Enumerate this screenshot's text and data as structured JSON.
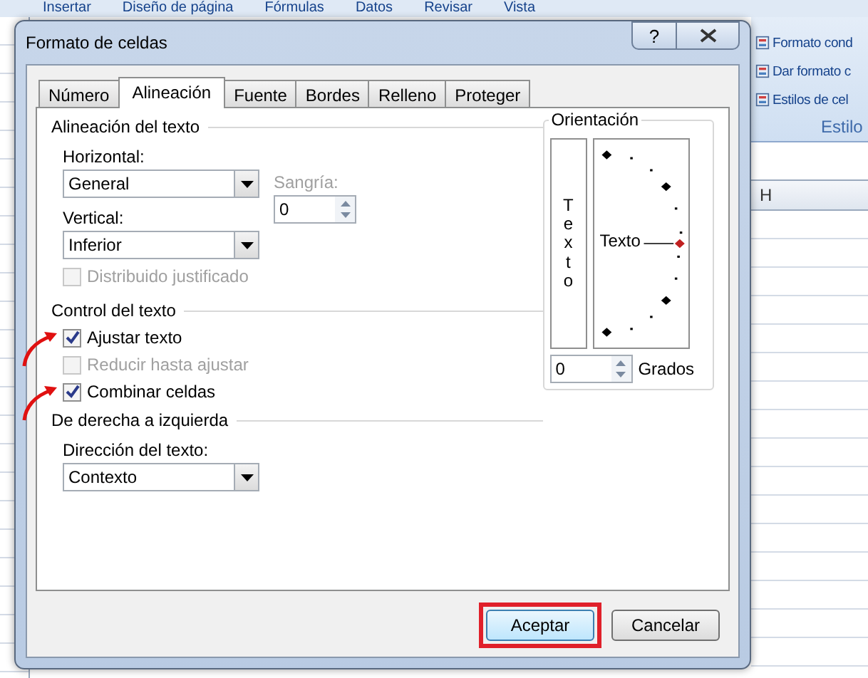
{
  "background": {
    "ribbon_tabs": [
      "Insertar",
      "Diseño de página",
      "Fórmulas",
      "Datos",
      "Revisar",
      "Vista"
    ],
    "ribbon_items": [
      "Formato cond",
      "Dar formato c",
      "Estilos de cel"
    ],
    "ribbon_group": "Estilo",
    "column_header": "H"
  },
  "dialog": {
    "title": "Formato de celdas",
    "help": "?",
    "tabs": [
      {
        "label": "Número",
        "selected": false
      },
      {
        "label": "Alineación",
        "selected": true
      },
      {
        "label": "Fuente",
        "selected": false
      },
      {
        "label": "Bordes",
        "selected": false
      },
      {
        "label": "Relleno",
        "selected": false
      },
      {
        "label": "Proteger",
        "selected": false
      }
    ],
    "text_alignment": {
      "title": "Alineación del texto",
      "horizontal": {
        "label": "Horizontal:",
        "value": "General"
      },
      "vertical": {
        "label": "Vertical:",
        "value": "Inferior"
      },
      "indent": {
        "label": "Sangría:",
        "value": "0"
      },
      "distributed": {
        "label": "Distribuido justificado",
        "checked": false,
        "disabled": true
      }
    },
    "text_control": {
      "title": "Control del texto",
      "options": [
        {
          "label": "Ajustar texto",
          "checked": true,
          "disabled": false,
          "annotated": true
        },
        {
          "label": "Reducir hasta ajustar",
          "checked": false,
          "disabled": true,
          "annotated": false
        },
        {
          "label": "Combinar celdas",
          "checked": true,
          "disabled": false,
          "annotated": true
        }
      ]
    },
    "rtl": {
      "title": "De derecha a izquierda",
      "direction": {
        "label": "Dirección del texto:",
        "value": "Contexto"
      }
    },
    "orientation": {
      "title": "Orientación",
      "vertical_text": "Texto",
      "dial_text": "Texto",
      "degrees": "0",
      "degrees_label": "Grados"
    },
    "buttons": [
      {
        "label": "Aceptar",
        "highlighted": true
      },
      {
        "label": "Cancelar",
        "highlighted": false
      }
    ]
  }
}
